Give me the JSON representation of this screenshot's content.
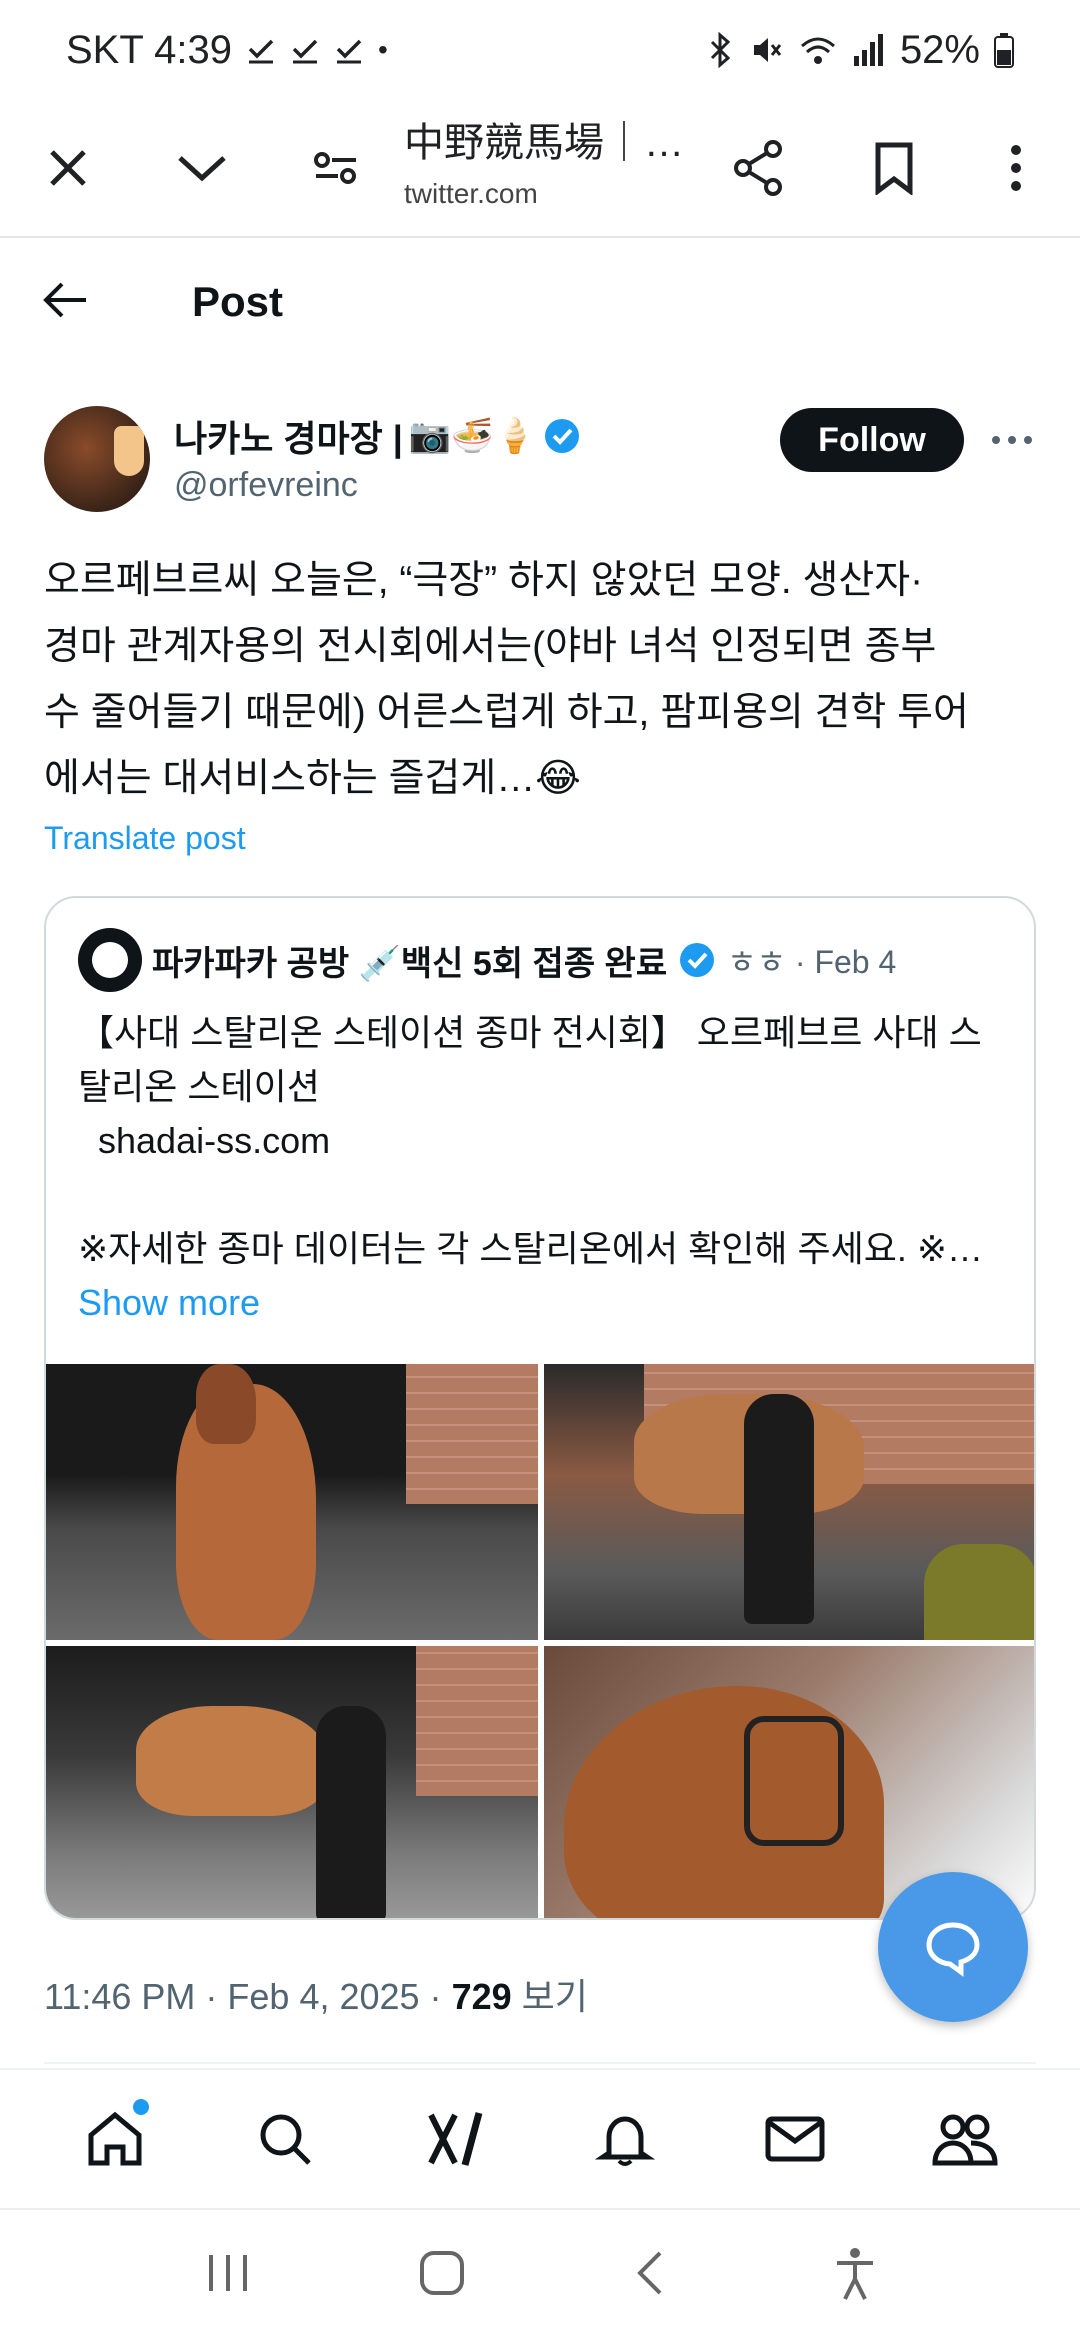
{
  "status_bar": {
    "carrier_time": "SKT 4:39",
    "dot": "•",
    "battery": "52%",
    "icons": [
      "check-icon",
      "check-icon",
      "check-icon",
      "bluetooth-icon",
      "mute-icon",
      "wifi-icon",
      "signal-icon",
      "battery-icon"
    ]
  },
  "browser": {
    "title": "中野競馬場｜…",
    "url": "twitter.com",
    "icons": [
      "close-icon",
      "chevron-down-icon",
      "page-settings-icon",
      "share-icon",
      "bookmark-icon",
      "more-vertical-icon"
    ]
  },
  "post_header": {
    "title": "Post"
  },
  "author": {
    "name": "나카노 경마장 |",
    "emojis": "📷🍜🍦",
    "handle": "@orfevreinc",
    "follow_label": "Follow",
    "verified_color": "#1d9bf0"
  },
  "post": {
    "lines": [
      "오르페브르씨 오늘은, “극장” 하지 않았던 모양. 생산자·",
      "경마 관계자용의 전시회에서는(야바 녀석 인정되면 종부",
      "수 줄어들기 때문에) 어른스럽게 하고, 팜피용의 견학 투어",
      "에서는 대서비스하는 즐겁게…😂"
    ],
    "translate_label": "Translate post"
  },
  "quote": {
    "name": "파카파카 공방 💉백신 5회 접종 완료",
    "meta": "ㅎㅎ · Feb 4",
    "lines": [
      "【사대 스탈리온 스테이션 종마 전시회】 오르페브르 사대 스",
      "탈리온 스테이션",
      "  shadai-ss.com",
      "",
      "※자세한 종마 데이터는 각 스탈리온에서 확인해 주세요. ※…"
    ],
    "show_more": "Show more"
  },
  "meta": {
    "time": "11:46 PM · Feb 4, 2025 · ",
    "views_count": "729",
    "views_label": " 보기"
  },
  "bottom_nav": {
    "items": [
      "home-icon",
      "search-icon",
      "grok-icon",
      "notifications-icon",
      "messages-icon",
      "communities-icon"
    ]
  },
  "system_nav": {
    "items": [
      "recents-icon",
      "home-button-icon",
      "back-icon",
      "accessibility-icon"
    ]
  },
  "colors": {
    "accent": "#1d9bf0",
    "fab": "#4a99e9",
    "text_secondary": "#536471"
  }
}
